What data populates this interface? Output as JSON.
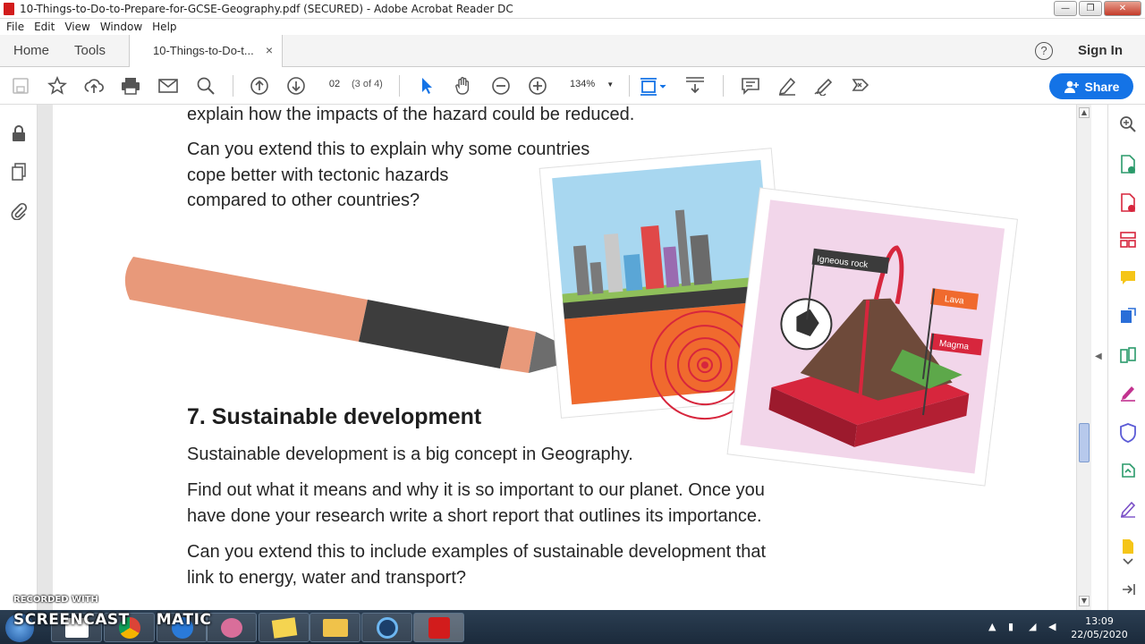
{
  "window": {
    "title": "10-Things-to-Do-to-Prepare-for-GCSE-Geography.pdf (SECURED) - Adobe Acrobat Reader DC",
    "controls": [
      "—",
      "❐",
      "✕"
    ]
  },
  "menubar": {
    "items": [
      "File",
      "Edit",
      "View",
      "Window",
      "Help"
    ]
  },
  "tabs": {
    "home": "Home",
    "tools": "Tools",
    "document": "10-Things-to-Do-t...",
    "close": "×",
    "help": "?",
    "signin": "Sign In"
  },
  "toolbar": {
    "page_number": "02",
    "page_of": "(3 of 4)",
    "zoom": "134%",
    "share_label": "Share"
  },
  "icons": {
    "save": "save-icon",
    "bookmark": "star-icon",
    "upload": "upload-icon",
    "print": "print-icon",
    "email": "mail-icon",
    "search": "search-icon",
    "prev": "arrow-up-circle-icon",
    "next": "arrow-down-circle-icon",
    "select": "cursor-icon",
    "hand": "hand-icon",
    "zoom_out": "minus-circle-icon",
    "zoom_in": "plus-circle-icon"
  },
  "document": {
    "para_top_1": "explain how the impacts of the hazard could be reduced.",
    "para_top_2": "Can you extend this to explain why some countries\ncope better with tectonic hazards\ncompared to other countries?",
    "heading": "7. Sustainable development",
    "para_1": "Sustainable development is a big concept in Geography.",
    "para_2": "Find out what it means and why it is so important to our planet. Once you\nhave done your research write a short report that outlines its importance.",
    "para_3": "Can you extend this to include examples of sustainable development that\nlink to energy, water and transport?",
    "illustration_labels": {
      "igneous": "Igneous rock",
      "lava": "Lava",
      "magma": "Magma"
    }
  },
  "colors": {
    "accent": "#1473e6",
    "pencil_body": "#e8997a",
    "pencil_band": "#3d3d3d",
    "ground": "#f06a2e",
    "volcano_red": "#d7263d"
  },
  "overlay": {
    "recorded_with": "RECORDED WITH",
    "screencast_a": "SCREENCAST",
    "screencast_b": "MATIC"
  },
  "taskbar": {
    "time": "13:09",
    "date": "22/05/2020"
  }
}
